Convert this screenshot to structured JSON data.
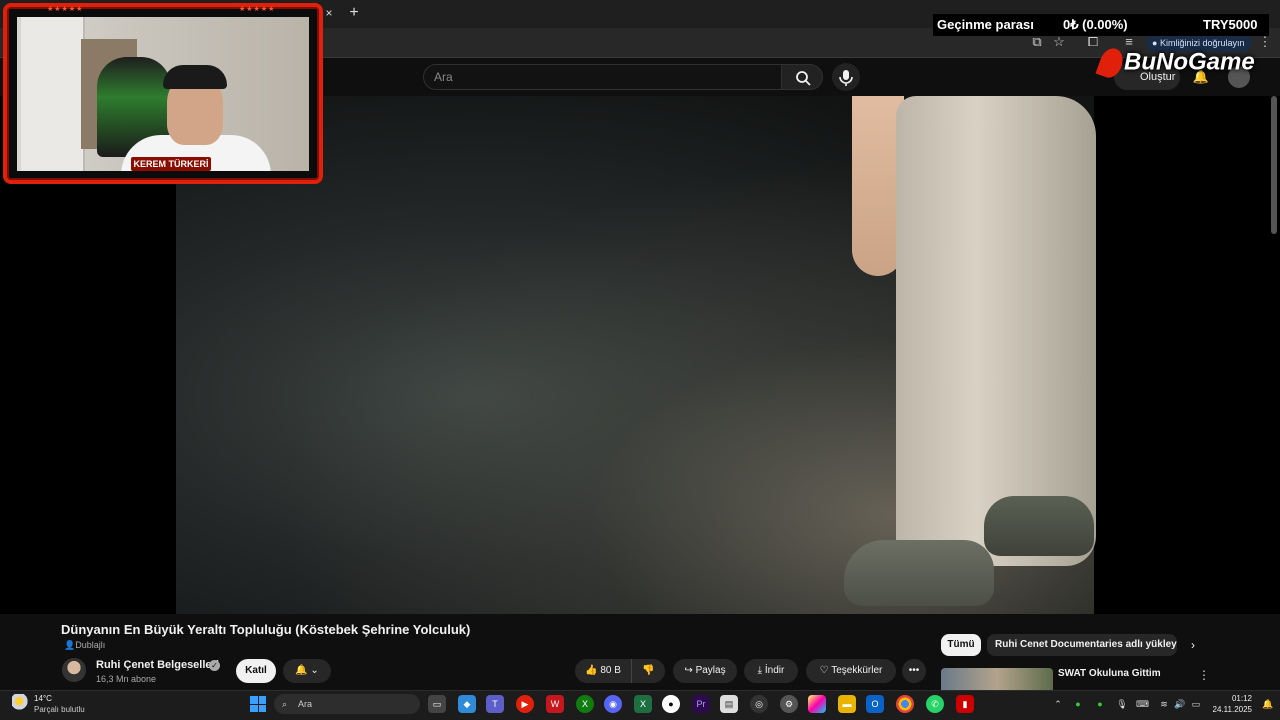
{
  "browser": {
    "tab_close": "×",
    "tab_new": "+",
    "identity_label": "Kimliğinizi doğrulayın"
  },
  "youtube": {
    "search_placeholder": "Ara",
    "create_label": "Oluştur"
  },
  "overlay": {
    "label": "Geçinme parası",
    "amount": "0₺ (0.00%)",
    "goal": "TRY5000",
    "brand": "BuNoGame",
    "webcam_name": "KEREM TÜRKERİ",
    "webcam_stars": "★★★★★"
  },
  "video": {
    "title": "Dünyanın En Büyük Yeraltı Topluluğu (Köstebek Şehrine Yolculuk)",
    "dubbed_label": "Dublajlı",
    "channel_name": "Ruhi Çenet Belgeselleri",
    "subscribers": "16,3 Mn abone",
    "join_label": "Katıl",
    "like_count": "80 B",
    "share_label": "Paylaş",
    "download_label": "İndir",
    "thanks_label": "Teşekkürler",
    "more_label": "•••"
  },
  "sidebar": {
    "chips": [
      "Tümü",
      "Ruhi Cenet Documentaries adlı yükleyiciden"
    ],
    "recommendation_title": "SWAT Okuluna Gittim"
  },
  "taskbar": {
    "temperature": "14°C",
    "weather": "Parçalı bulutlu",
    "search_placeholder": "Ara",
    "time": "01:12",
    "date": "24.11.2025"
  }
}
